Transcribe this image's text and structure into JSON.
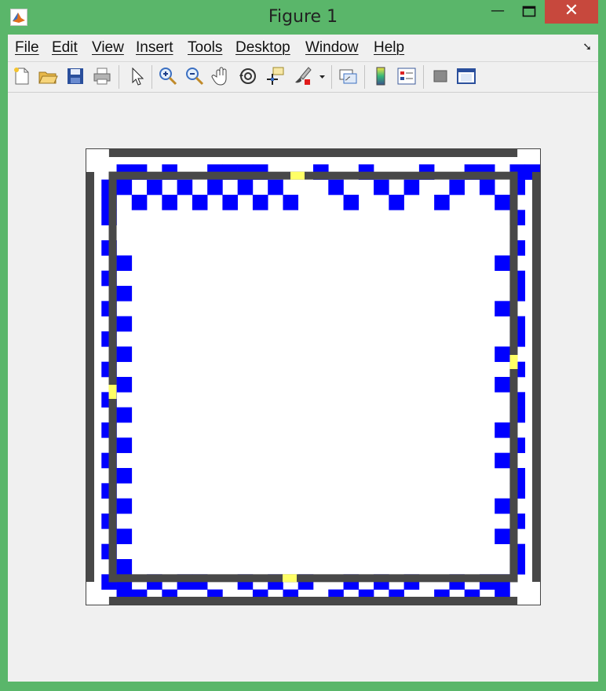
{
  "window": {
    "title": "Figure 1",
    "minimize_glyph": "—",
    "maximize_glyph": "☐",
    "close_glyph": "✕"
  },
  "menu": [
    "File",
    "Edit",
    "View",
    "Insert",
    "Tools",
    "Desktop",
    "Window",
    "Help"
  ],
  "toolbar": {
    "icons": [
      "new-figure-icon",
      "open-file-icon",
      "save-figure-icon",
      "print-figure-icon",
      "edit-plot-arrow-icon",
      "zoom-in-icon",
      "zoom-out-icon",
      "pan-hand-icon",
      "rotate-3d-icon",
      "data-cursor-icon",
      "brush-icon",
      "brush-dropdown-icon",
      "link-plot-icon",
      "insert-colorbar-icon",
      "insert-legend-icon",
      "hide-plot-tools-icon",
      "show-plot-tools-icon"
    ]
  },
  "colors": {
    "window_frame": "#5ab66a",
    "wall": "#484848",
    "blue_cell": "#0000ff",
    "yellow_cell": "#ffff66",
    "background": "#ffffff"
  },
  "grid": {
    "size": 30,
    "note_values": "cell indices (col,row), 0..29"
  }
}
